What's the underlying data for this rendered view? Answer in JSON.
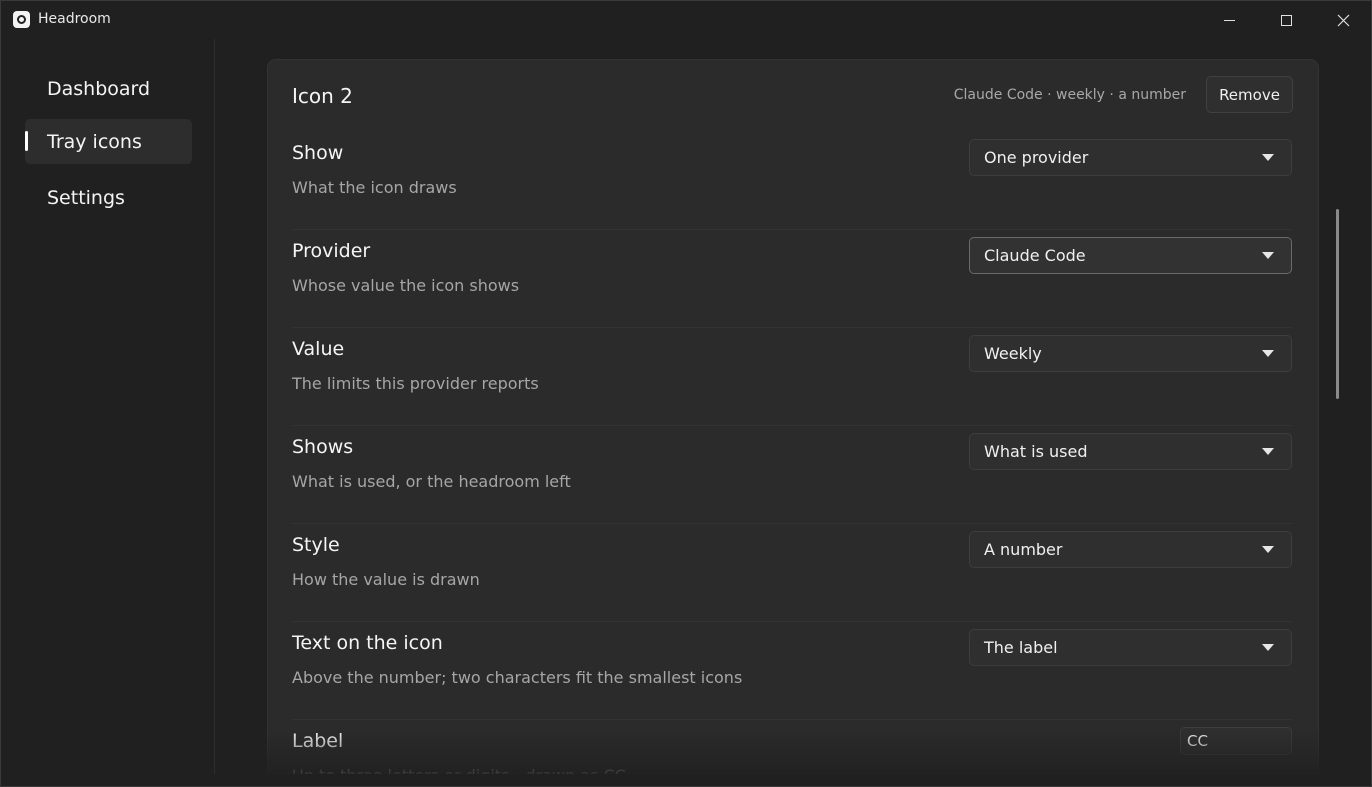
{
  "window": {
    "title": "Headroom"
  },
  "sidebar": {
    "items": [
      {
        "label": "Dashboard"
      },
      {
        "label": "Tray icons"
      },
      {
        "label": "Settings"
      }
    ]
  },
  "card": {
    "title": "Icon 2",
    "summary": "Claude Code · weekly · a number",
    "remove_label": "Remove",
    "rows": [
      {
        "label": "Show",
        "description": "What the icon draws",
        "value": "One provider"
      },
      {
        "label": "Provider",
        "description": "Whose value the icon shows",
        "value": "Claude Code"
      },
      {
        "label": "Value",
        "description": "The limits this provider reports",
        "value": "Weekly"
      },
      {
        "label": "Shows",
        "description": "What is used, or the headroom left",
        "value": "What is used"
      },
      {
        "label": "Style",
        "description": "How the value is drawn",
        "value": "A number"
      },
      {
        "label": "Text on the icon",
        "description": "Above the number; two characters fit the smallest icons",
        "value": "The label"
      },
      {
        "label": "Label",
        "description": "Up to three letters or digits - drawn as CC",
        "value": "CC"
      }
    ]
  },
  "icons": {
    "app": "headroom-app-icon",
    "minimize": "minimize-icon",
    "maximize": "maximize-icon",
    "close": "close-icon",
    "dropdown": "chevron-down-icon"
  }
}
